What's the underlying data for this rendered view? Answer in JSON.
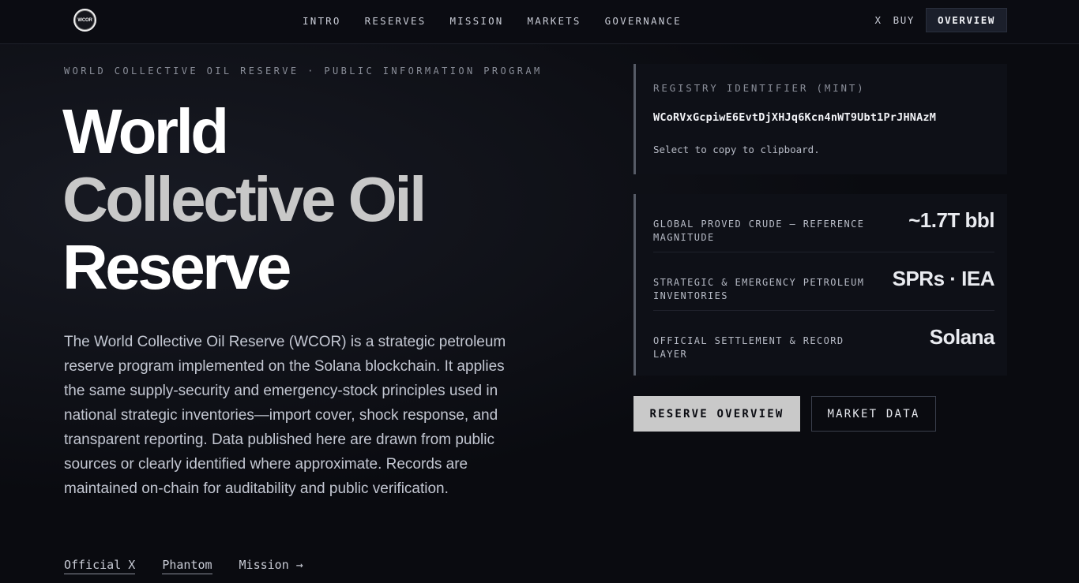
{
  "header": {
    "logo_text": "WCOR",
    "nav": [
      "INTRO",
      "RESERVES",
      "MISSION",
      "MARKETS",
      "GOVERNANCE"
    ],
    "link_x": "X",
    "link_buy": "BUY",
    "overview_button": "OVERVIEW"
  },
  "hero": {
    "eyebrow": "WORLD COLLECTIVE OIL RESERVE · PUBLIC INFORMATION PROGRAM",
    "title_line1": "World",
    "title_line2": "Collective Oil",
    "title_line3": "Reserve",
    "description": "The World Collective Oil Reserve (WCOR) is a strategic petroleum reserve program implemented on the Solana blockchain. It applies the same supply-security and emergency-stock principles used in national strategic inventories—import cover, shock response, and transparent reporting. Data published here are drawn from public sources or clearly identified where approximate. Records are maintained on-chain for auditability and public verification.",
    "links": {
      "official_x": "Official X",
      "phantom": "Phantom",
      "mission": "Mission →"
    }
  },
  "registry": {
    "label": "REGISTRY IDENTIFIER (MINT)",
    "value": "WCoRVxGcpiwE6EvtDjXHJq6Kcn4nWT9Ubt1PrJHNAzM",
    "hint": "Select to copy to clipboard."
  },
  "stats": [
    {
      "label": "GLOBAL PROVED CRUDE — REFERENCE MAGNITUDE",
      "value": "~1.7T bbl"
    },
    {
      "label": "STRATEGIC & EMERGENCY PETROLEUM INVENTORIES",
      "value": "SPRs · IEA"
    },
    {
      "label": "OFFICIAL SETTLEMENT & RECORD LAYER",
      "value": "Solana"
    }
  ],
  "cta": {
    "primary": "RESERVE OVERVIEW",
    "secondary": "MARKET DATA"
  }
}
